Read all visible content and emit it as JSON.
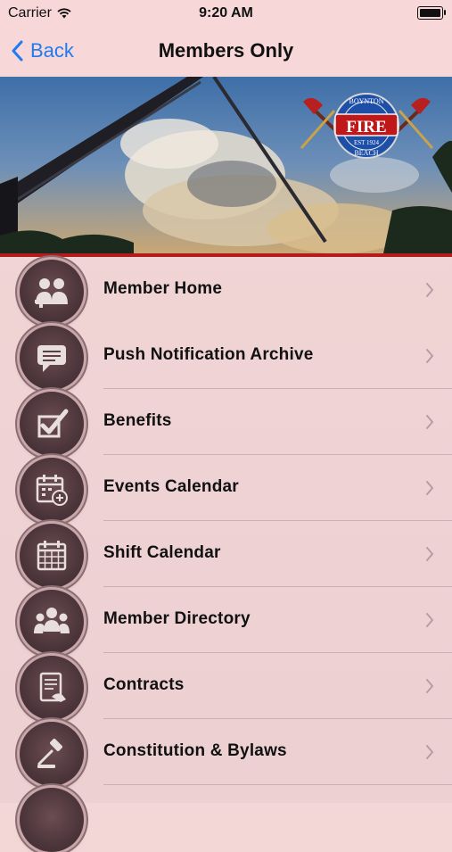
{
  "status": {
    "carrier": "Carrier",
    "time": "9:20 AM"
  },
  "nav": {
    "back_label": "Back",
    "title": "Members Only"
  },
  "banner": {
    "logo": {
      "top": "BOYNTON",
      "main": "FIRE",
      "est": "EST 1924",
      "bottom": "BEACH"
    }
  },
  "menu": [
    {
      "label": "Member Home",
      "icon": "members-icon"
    },
    {
      "label": "Push Notification Archive",
      "icon": "message-icon"
    },
    {
      "label": "Benefits",
      "icon": "checkbox-icon"
    },
    {
      "label": "Events Calendar",
      "icon": "calendar-add-icon"
    },
    {
      "label": "Shift Calendar",
      "icon": "calendar-grid-icon"
    },
    {
      "label": "Member Directory",
      "icon": "directory-icon"
    },
    {
      "label": "Contracts",
      "icon": "contract-icon"
    },
    {
      "label": "Constitution & Bylaws",
      "icon": "gavel-icon"
    }
  ],
  "colors": {
    "accent": "#1e7bf2",
    "banner_border": "#b51b1b"
  }
}
